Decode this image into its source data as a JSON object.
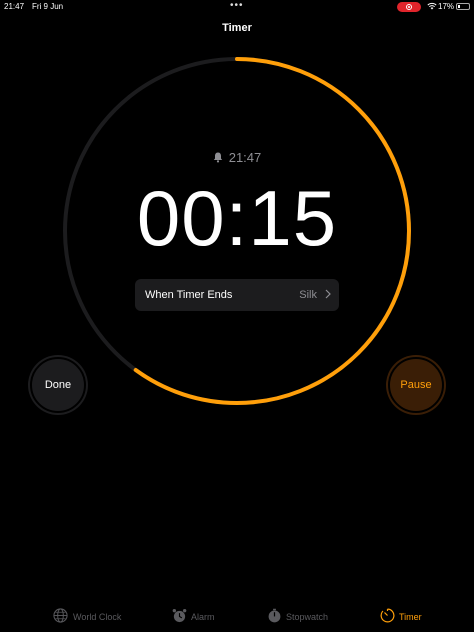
{
  "status_bar": {
    "time": "21:47",
    "date": "Fri 9 Jun",
    "battery": "17%",
    "battery_level": 0.17
  },
  "header": {
    "title": "Timer"
  },
  "timer": {
    "end_time": "21:47",
    "remaining": "00:15",
    "progress_remaining": 0.6,
    "when_timer_ends_label": "When Timer Ends",
    "sound": "Silk"
  },
  "buttons": {
    "done": "Done",
    "pause": "Pause"
  },
  "tabs": [
    {
      "label": "World Clock",
      "icon": "globe-icon"
    },
    {
      "label": "Alarm",
      "icon": "alarm-icon"
    },
    {
      "label": "Stopwatch",
      "icon": "stopwatch-icon"
    },
    {
      "label": "Timer",
      "icon": "timer-icon",
      "active": true
    }
  ],
  "colors": {
    "accent": "#ff9f0a",
    "track": "#1c1c1e",
    "background": "#000000"
  }
}
